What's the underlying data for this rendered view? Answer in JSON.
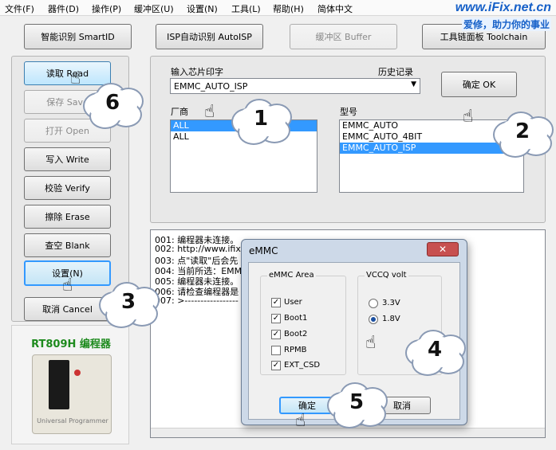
{
  "menu": [
    "文件(F)",
    "器件(D)",
    "操作(P)",
    "缓冲区(U)",
    "设置(N)",
    "工具(L)",
    "帮助(H)",
    "简体中文"
  ],
  "brand": {
    "url": "www.iFix.net.cn",
    "slogan": "爱修，助力你的事业"
  },
  "toolbar": {
    "smart_id": "智能识别 SmartID",
    "isp_id": "ISP自动识别 AutoISP",
    "buffer": "缓冲区 Buffer",
    "toolchain": "工具链面板 Toolchain"
  },
  "side_buttons": {
    "read": "读取 Read",
    "save": "保存 Save",
    "open": "打开 Open",
    "write": "写入 Write",
    "verify": "校验 Verify",
    "erase": "擦除 Erase",
    "blank": "查空 Blank",
    "settings": "设置(N)",
    "cancel": "取消 Cancel"
  },
  "device": {
    "title": "RT809H 编程器",
    "caption": "Universal Programmer"
  },
  "chip": {
    "label": "输入芯片印字",
    "history_label": "历史记录",
    "value": "EMMC_AUTO_ISP",
    "ok": "确定 OK"
  },
  "vendor": {
    "label": "厂商",
    "items": [
      "ALL",
      "ALL"
    ],
    "selected": 0
  },
  "model": {
    "label": "型号",
    "items": [
      "EMMC_AUTO",
      "EMMC_AUTO_4BIT",
      "EMMC_AUTO_ISP"
    ],
    "selected": 2
  },
  "log": [
    "001: 编程器未连接。",
    "002: http://www.ifix.n",
    "003: 点\"读取\"后会先",
    "004: 当前所选：EMM",
    "005: 编程器未连接。",
    "006: 请检查编程器是",
    "007: >-----------------"
  ],
  "dialog": {
    "title": "eMMC",
    "area_title": "eMMC Area",
    "areas": [
      {
        "label": "User",
        "checked": true
      },
      {
        "label": "Boot1",
        "checked": true
      },
      {
        "label": "Boot2",
        "checked": true
      },
      {
        "label": "RPMB",
        "checked": false
      },
      {
        "label": "EXT_CSD",
        "checked": true
      }
    ],
    "volt_title": "VCCQ volt",
    "volts": [
      {
        "label": "3.3V",
        "selected": false
      },
      {
        "label": "1.8V",
        "selected": true
      }
    ],
    "ok": "确定",
    "cancel": "取消"
  },
  "callouts": [
    "1",
    "2",
    "3",
    "4",
    "5",
    "6"
  ],
  "icons": {
    "hand": "hand-pointer-icon",
    "close": "close-icon",
    "dropdown": "chevron-down-icon",
    "check": "checkmark-icon"
  }
}
